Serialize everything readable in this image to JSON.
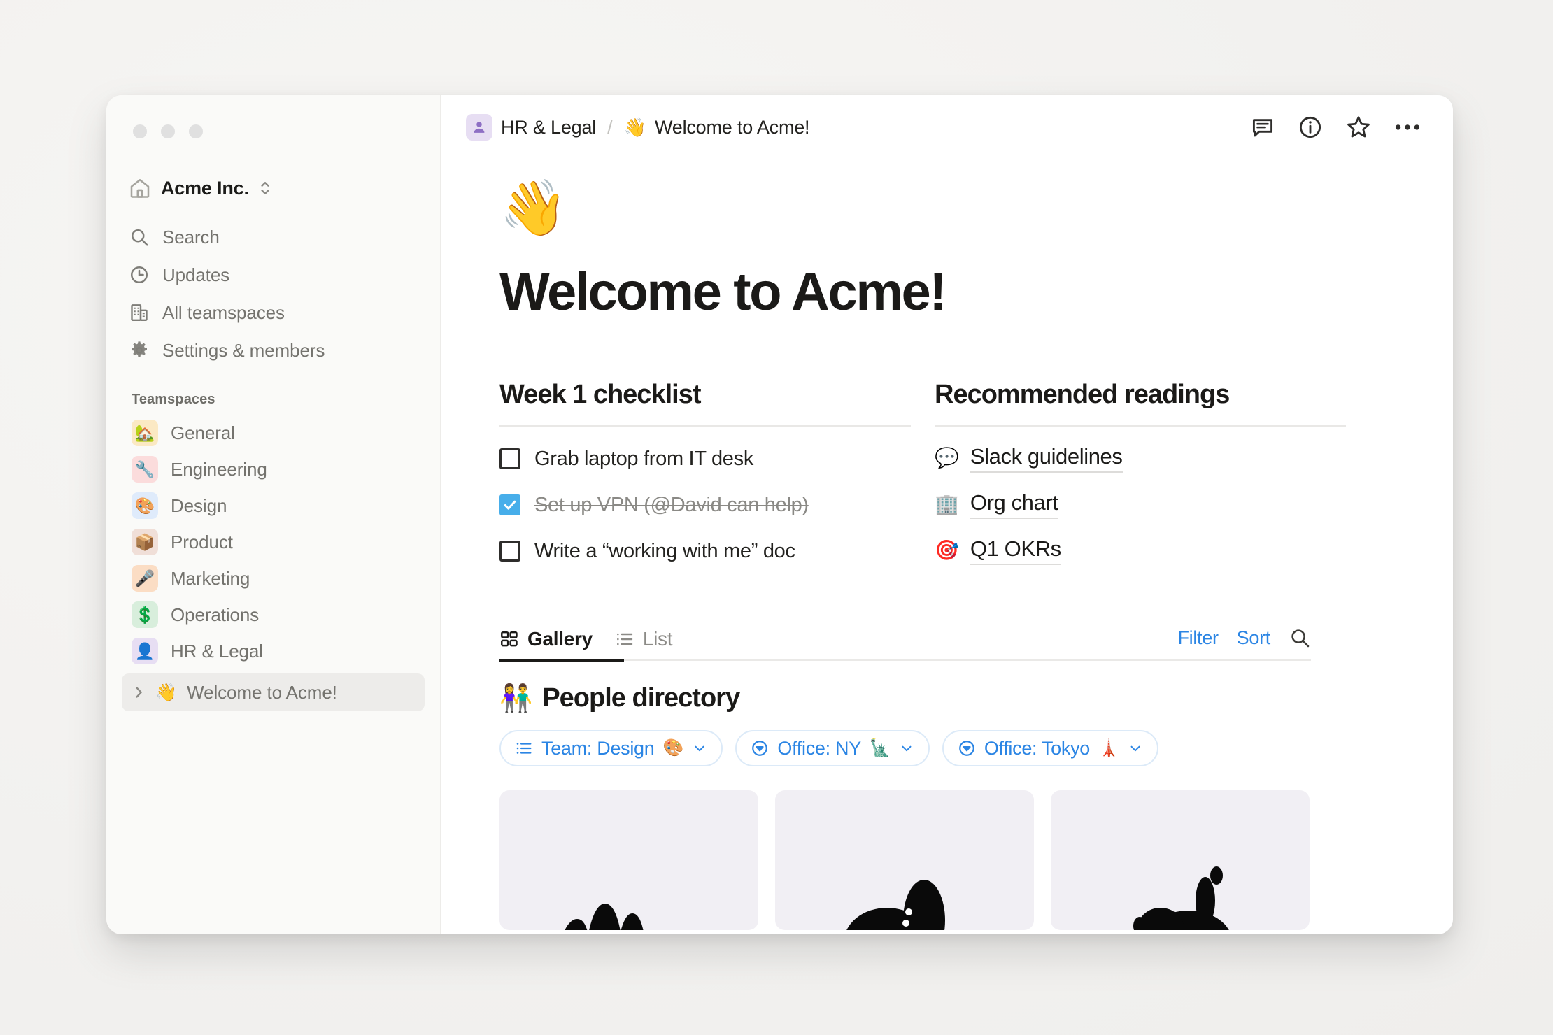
{
  "window": {
    "traffic_lights": [
      "close",
      "minimize",
      "zoom"
    ]
  },
  "sidebar": {
    "workspace": {
      "name": "Acme Inc.",
      "icon": "home-icon",
      "switcher_icon": "chevron-up-down-icon"
    },
    "nav": [
      {
        "label": "Search",
        "icon": "search-icon"
      },
      {
        "label": "Updates",
        "icon": "clock-icon"
      },
      {
        "label": "All teamspaces",
        "icon": "building-icon"
      },
      {
        "label": "Settings & members",
        "icon": "gear-icon"
      }
    ],
    "teamspaces_label": "Teamspaces",
    "teamspaces": [
      {
        "label": "General",
        "emoji": "🏡",
        "bg": "#FBE9C4"
      },
      {
        "label": "Engineering",
        "emoji": "🔧",
        "bg": "#FBDCDC"
      },
      {
        "label": "Design",
        "emoji": "🎨",
        "bg": "#DFEBFB"
      },
      {
        "label": "Product",
        "emoji": "📦",
        "bg": "#F0DFD8"
      },
      {
        "label": "Marketing",
        "emoji": "🎤",
        "bg": "#FBDDC4"
      },
      {
        "label": "Operations",
        "emoji": "💲",
        "bg": "#D8EEDC"
      },
      {
        "label": "HR & Legal",
        "emoji": "👤",
        "bg": "#E7DEF3"
      }
    ],
    "pages": [
      {
        "label": "Welcome to Acme!",
        "emoji": "👋",
        "selected": true,
        "expander": "chevron-right-icon"
      }
    ]
  },
  "topbar": {
    "breadcrumb": {
      "parent": "HR & Legal",
      "parent_icon": "person-icon",
      "separator": "/",
      "current": "Welcome to Acme!",
      "current_emoji": "👋"
    },
    "actions": [
      {
        "name": "comments-icon"
      },
      {
        "name": "info-icon"
      },
      {
        "name": "star-icon"
      },
      {
        "name": "more-options-icon"
      }
    ]
  },
  "page": {
    "emoji": "👋",
    "title": "Welcome to Acme!"
  },
  "checklist": {
    "heading": "Week 1 checklist",
    "items": [
      {
        "text": "Grab laptop from IT desk",
        "checked": false
      },
      {
        "text": "Set up VPN (@David can help)",
        "checked": true
      },
      {
        "text": "Write a “working with me” doc",
        "checked": false
      }
    ]
  },
  "readings": {
    "heading": "Recommended readings",
    "items": [
      {
        "text": "Slack guidelines",
        "emoji": "💬"
      },
      {
        "text": "Org chart",
        "emoji": "🏢"
      },
      {
        "text": "Q1 OKRs",
        "emoji": "🎯"
      }
    ]
  },
  "database": {
    "views": [
      {
        "label": "Gallery",
        "icon": "gallery-grid-icon",
        "active": true
      },
      {
        "label": "List",
        "icon": "list-icon",
        "active": false
      }
    ],
    "actions": [
      {
        "label": "Filter"
      },
      {
        "label": "Sort"
      }
    ],
    "search_icon": "search-icon",
    "title": "People directory",
    "title_emoji": "👫",
    "filters": [
      {
        "label": "Team: Design",
        "emoji": "🎨",
        "icon": "list-icon",
        "chevron": "chevron-down-icon"
      },
      {
        "label": "Office: NY",
        "emoji": "🗽",
        "icon": "circle-caret-down-icon",
        "chevron": "chevron-down-icon"
      },
      {
        "label": "Office: Tokyo",
        "emoji": "🗼",
        "icon": "circle-caret-down-icon",
        "chevron": "chevron-down-icon"
      }
    ],
    "cards": [
      {
        "name": "person-card-1"
      },
      {
        "name": "person-card-2"
      },
      {
        "name": "person-card-3"
      }
    ]
  },
  "colors": {
    "accent_blue": "#2B85E4",
    "checkbox_blue": "#47AEEA",
    "sidebar_bg": "#FAFAF8",
    "card_bg": "#F1EFF4",
    "text_primary": "#1B1A18",
    "text_muted": "#74736E"
  }
}
